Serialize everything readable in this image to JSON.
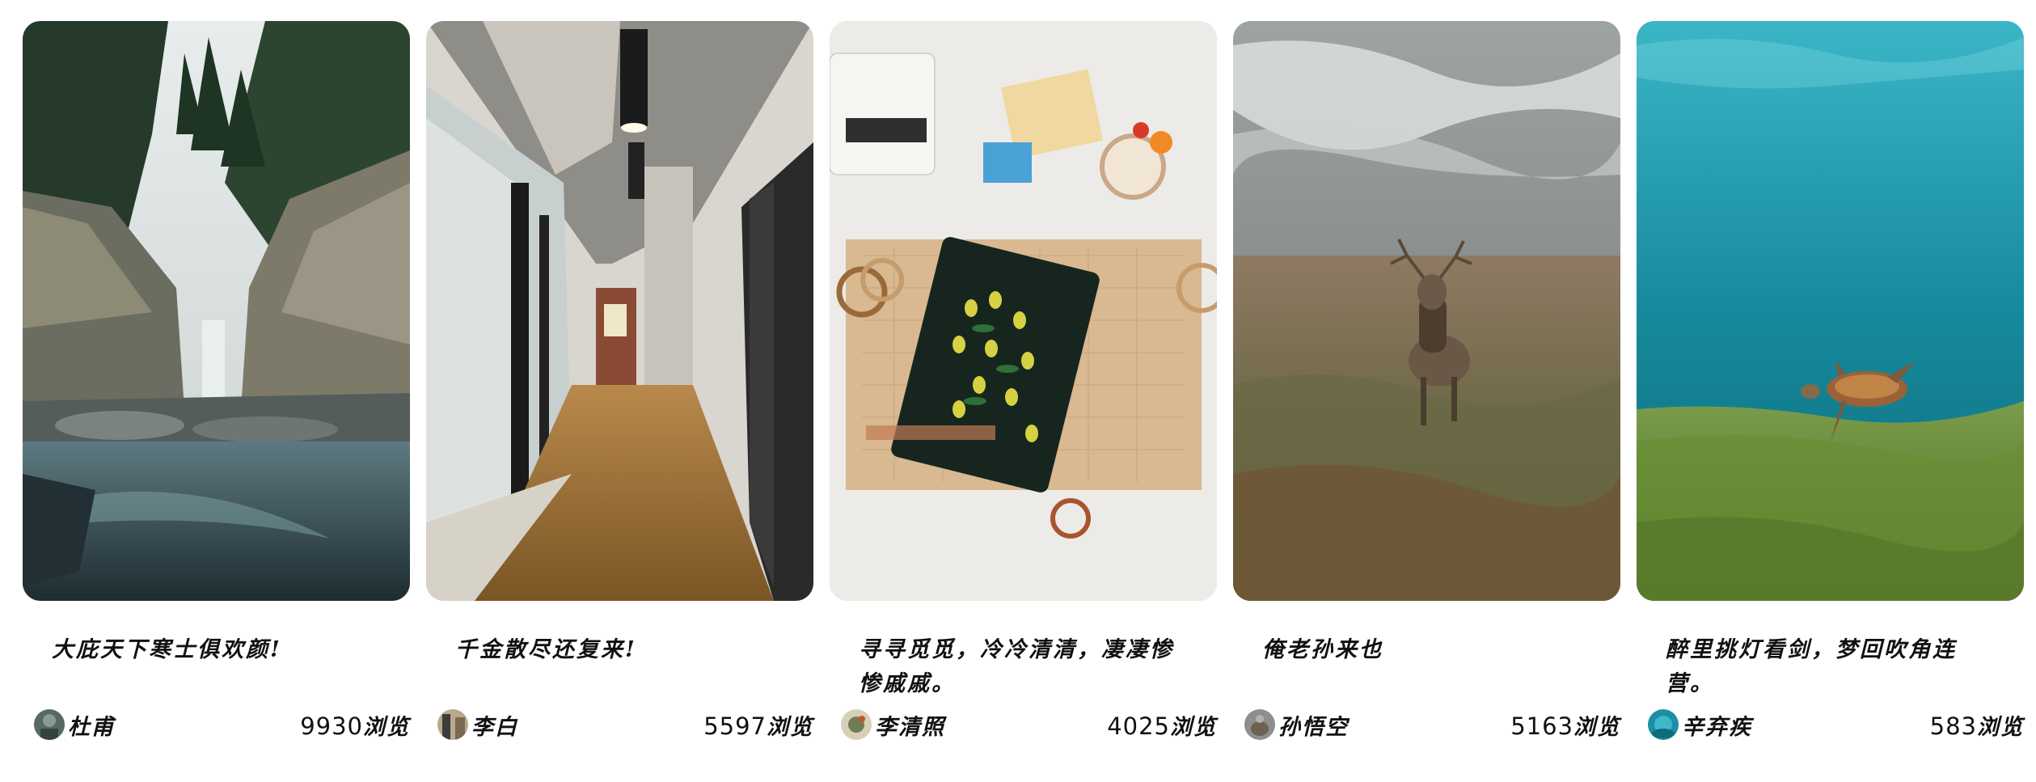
{
  "cards": [
    {
      "image": "waterfall-forest-coast-photo",
      "title": "大庇天下寒士俱欢颜!",
      "author": "杜甫",
      "views": "9930",
      "views_label": "浏览"
    },
    {
      "image": "office-glass-corridor-photo",
      "title": "千金散尽还复来!",
      "author": "李白",
      "views": "5597",
      "views_label": "浏览"
    },
    {
      "image": "desk-notebook-stationery-photo",
      "title": "寻寻觅觅，冷冷清清，凄凄惨惨戚戚。",
      "author": "李清照",
      "views": "4025",
      "views_label": "浏览"
    },
    {
      "image": "deer-in-grassland-photo",
      "title": "俺老孙来也",
      "author": "孙悟空",
      "views": "5163",
      "views_label": "浏览"
    },
    {
      "image": "sea-turtle-underwater-photo",
      "title": "醉里挑灯看剑，梦回吹角连营。",
      "author": "辛弃疾",
      "views": "583",
      "views_label": "浏览"
    }
  ]
}
